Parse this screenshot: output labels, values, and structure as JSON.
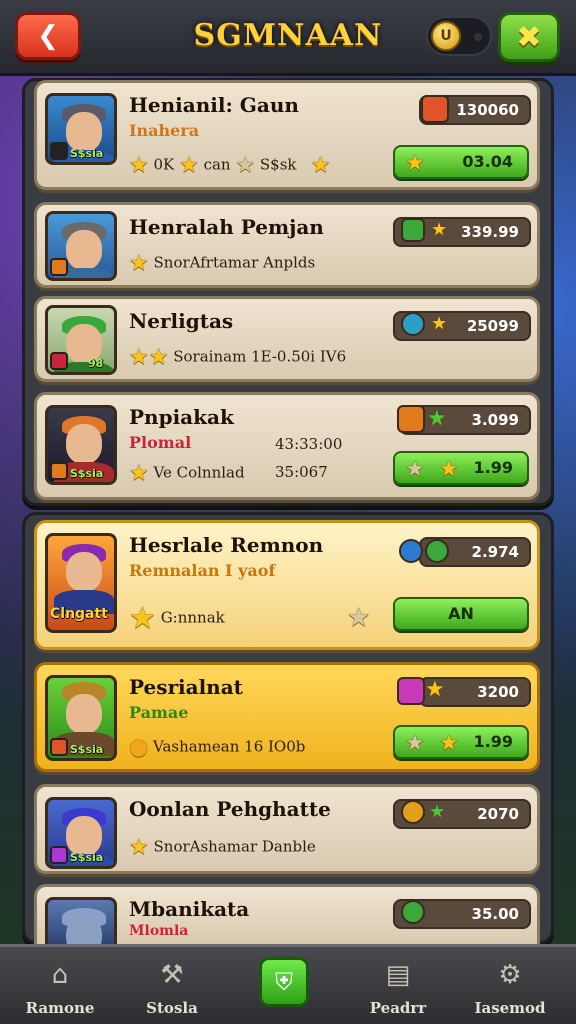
{
  "header": {
    "title": "SGMNAAN",
    "back_icon": "back-arrow-icon",
    "close_icon": "close-x-icon"
  },
  "cards": [
    {
      "name": "Henianil: Gaun",
      "sub": "Inahera",
      "info": [
        "0K",
        "can",
        "S$sk"
      ],
      "value": "130060",
      "action_value": "03.04",
      "tag": "S$sia",
      "accent": "#e0542a"
    },
    {
      "name": "Henralah Pemjan",
      "info_text": "SnorAfrtamar Anplds",
      "value": "339.99",
      "tag": "",
      "accent": "#3aa83a"
    },
    {
      "name": "Nerligtas",
      "info_text": "Sorainam 1E-0.50i IV6",
      "value": "25099",
      "tag": "98",
      "accent": "#2aa0c8"
    },
    {
      "name": "Pnpiakak",
      "sub": "Plomal",
      "time": "43:33:00",
      "info_text": "Ve Colnnlad",
      "time2": "35:067",
      "value": "3.099",
      "action_value": "1.99",
      "tag": "S$sia",
      "accent": "#e07a1a"
    },
    {
      "name": "Hesrlale Remnon",
      "sub": "Remnalan I yaof",
      "info_text": "G:nnnak",
      "value": "2.974",
      "action_label": "AN",
      "tag": "Clngatt",
      "accent": "#2a7ad0"
    },
    {
      "name": "Pesrialnat",
      "sub": "Pamae",
      "info_text": "Vashamean 16 IO0b",
      "value": "3200",
      "action_value": "1.99",
      "tag": "S$sia",
      "accent": "#c83ab8"
    },
    {
      "name": "Oonlan Pehghatte",
      "info_text": "SnorAshamar Danble",
      "value": "2070",
      "tag": "S$sia",
      "accent": "#e0a01a"
    },
    {
      "name": "Mbanikata",
      "sub": "Mlomla",
      "value": "35.00",
      "accent": "#3aa83a"
    }
  ],
  "nav": [
    {
      "label": "Ramone",
      "icon": "home-icon"
    },
    {
      "label": "Stosla",
      "icon": "tools-icon"
    },
    {
      "label": "",
      "icon": "shield-icon"
    },
    {
      "label": "Peadrr",
      "icon": "clipboard-icon"
    },
    {
      "label": "Iasemod",
      "icon": "settings-icon"
    }
  ]
}
